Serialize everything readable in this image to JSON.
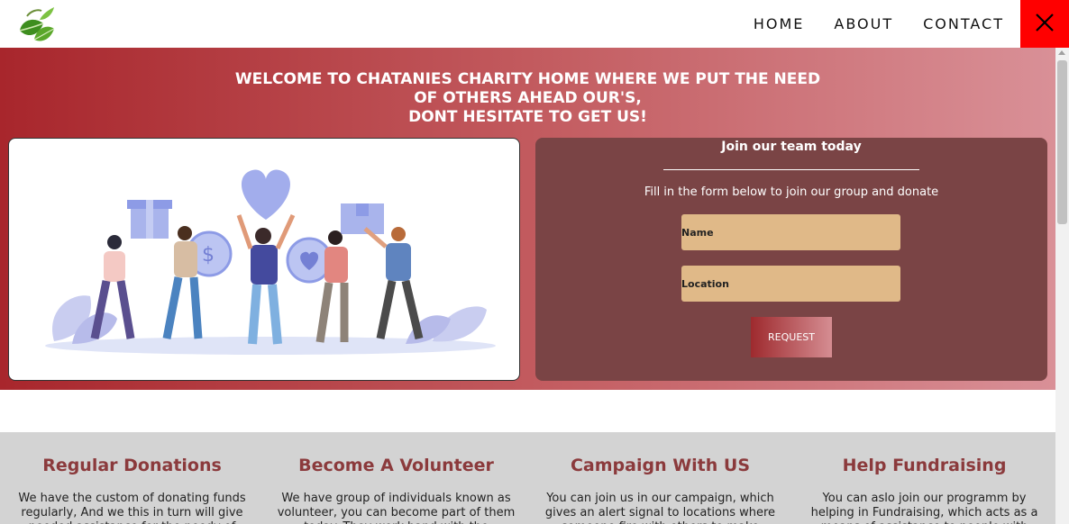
{
  "nav": {
    "links": [
      "HOME",
      "ABOUT",
      "CONTACT"
    ],
    "close_label": "✕"
  },
  "hero": {
    "title_lines": [
      "WELCOME TO CHATANIES CHARITY HOME WHERE WE PUT THE NEED",
      "OF OTHERS AHEAD OUR'S,",
      "DONT HESITATE TO GET US!"
    ]
  },
  "form": {
    "title": "Join our team today",
    "description": "Fill in the form below to join our group and donate",
    "name_placeholder": "Name",
    "location_placeholder": "Location",
    "button_label": "REQUEST"
  },
  "services": [
    {
      "title": "Regular Donations",
      "text": "We have the custom of donating funds regularly, And we this in turn will give needed assistance for the needy of"
    },
    {
      "title": "Become A Volunteer",
      "text": "We have group of individuals known as volunteer, you can become part of them today. They work hand with the"
    },
    {
      "title": "Campaign With US",
      "text": "You can join us in our campaign, which gives an alert signal to locations where someone fire with others to make"
    },
    {
      "title": "Help Fundraising",
      "text": "You can aslo join our programm by helping in Fundraising, which acts as a means of assistance to people with"
    }
  ],
  "colors": {
    "close_bg": "#ff0000",
    "hero_gradient_start": "#a8262c",
    "hero_gradient_end": "#d99097",
    "form_bg": "#7a4445",
    "field_bg": "#e0b988",
    "service_title": "#8b3a3c",
    "services_bg": "#d3d3d3"
  },
  "icons": {
    "logo": "leaf-logo-icon",
    "close": "close-icon"
  }
}
